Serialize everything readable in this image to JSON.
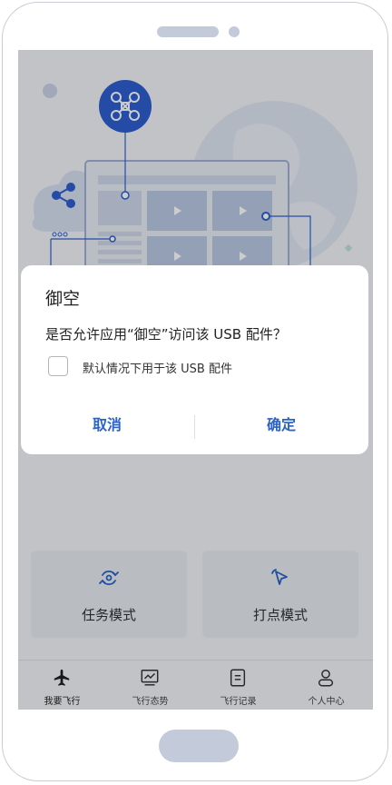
{
  "screen": {
    "cards": [
      {
        "label": "任务模式",
        "icon": "rotate-arrows-icon"
      },
      {
        "label": "打点模式",
        "icon": "cursor-pointer-icon"
      }
    ],
    "tabs": [
      {
        "label": "我要飞行",
        "icon": "airplane-icon",
        "active": true
      },
      {
        "label": "飞行态势",
        "icon": "line-chart-icon"
      },
      {
        "label": "飞行记录",
        "icon": "document-icon"
      },
      {
        "label": "个人中心",
        "icon": "person-icon"
      }
    ]
  },
  "dialog": {
    "title": "御空",
    "message": "是否允许应用“御空”访问该 USB 配件？",
    "checkbox_label": "默认情况下用于该 USB 配件",
    "checkbox_checked": false,
    "cancel_label": "取消",
    "confirm_label": "确定"
  },
  "colors": {
    "accent": "#2a62c9",
    "drone_badge": "#2d5fd1",
    "illustration": "#aebfe0"
  }
}
